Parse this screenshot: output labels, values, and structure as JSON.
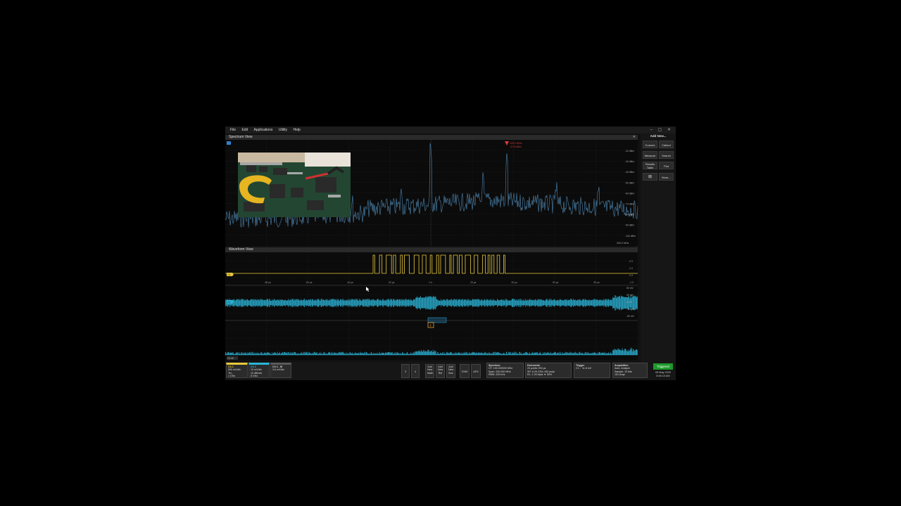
{
  "menu": [
    "File",
    "Edit",
    "Applications",
    "Utility",
    "Help"
  ],
  "window_controls": "– ▢ ✕",
  "spectrum": {
    "title": "Spectrum View",
    "marker_freq": "125.2 MHz",
    "marker_level": "-47.8 dBm",
    "y_ticks": [
      "-24 dBm",
      "-34 dBm",
      "-44 dBm",
      "-54 dBm",
      "-64 dBm",
      "-74 dBm",
      "-84 dBm",
      "-94 dBm",
      "-104 dBm"
    ],
    "span_label": "200.0 MHz"
  },
  "waveform": {
    "title": "Waveform View",
    "x_ticks": [
      "-80 μs",
      "-60 μs",
      "-40 μs",
      "-20 μs",
      "0 s",
      "20 μs",
      "40 μs",
      "60 μs",
      "80 μs"
    ],
    "ch1_label": "C1",
    "ch2_label": "C2",
    "ch1_scale": [
      "2 V",
      "1 V",
      "0 V",
      "-1 V"
    ],
    "ch2_scale": [
      "60 mV",
      "30 mV",
      "0 mV",
      "-30 mV",
      "-60 mV"
    ],
    "ch2_mag_label": "C2-M",
    "trigger_marker": "T"
  },
  "sidebar": {
    "add_new": "Add New...",
    "buttons": [
      "Cursors",
      "Callout",
      "Measure",
      "Search",
      "Results Table",
      "Plot",
      "More..."
    ]
  },
  "status": {
    "ch1": {
      "head": "Ch 1",
      "lines": [
        "500 mV/div",
        "Ter...",
        "1 GHz"
      ]
    },
    "ch2": {
      "head": "Ch 2",
      "lines": [
        "10 mV/div",
        "10 dBmdv",
        "8 GHz"
      ]
    },
    "ch2m": {
      "head": "Ch 2 - M",
      "lines": [
        "3.6 mV/div"
      ]
    },
    "small_buttons": [
      "3",
      "4"
    ],
    "add_buttons": [
      "Add New Math",
      "Add New Ref",
      "Add New Bus"
    ],
    "dvm": "DVM",
    "afg": "AFG",
    "spectrum": {
      "head": "Spectrum",
      "lines": [
        "CF: 100.000000 MHz",
        "Span: 200.000 MHz",
        "RBW: 200 kHz"
      ]
    },
    "horizontal": {
      "head": "Horizontal",
      "lines": [
        "20 μs/div    200 μs",
        "SR: 6.25 GS/s   160 ps/pt",
        "RL: 1.25 Mpts   ▼ 50%"
      ]
    },
    "trigger": {
      "head": "Trigger",
      "lines": [
        "C1  ⟋  11.8 mV"
      ]
    },
    "acquisition": {
      "head": "Acquisition",
      "lines": [
        "Auto,      Analyze",
        "Sample: 12 bits",
        "151 Acqs"
      ]
    },
    "triggered": "Triggered",
    "date": "05 May 2020",
    "time": "8:45:13 AM"
  },
  "colors": {
    "ch1": "#e8c93a",
    "ch2": "#2bb5d8",
    "spectrum_trace": "#4e86b0",
    "marker": "#d83a3a",
    "triggered": "#1d9a2b"
  },
  "icons": [
    "close-icon",
    "marker-icon",
    "trigger-icon",
    "zoom-icon",
    "mouse-cursor-icon"
  ]
}
